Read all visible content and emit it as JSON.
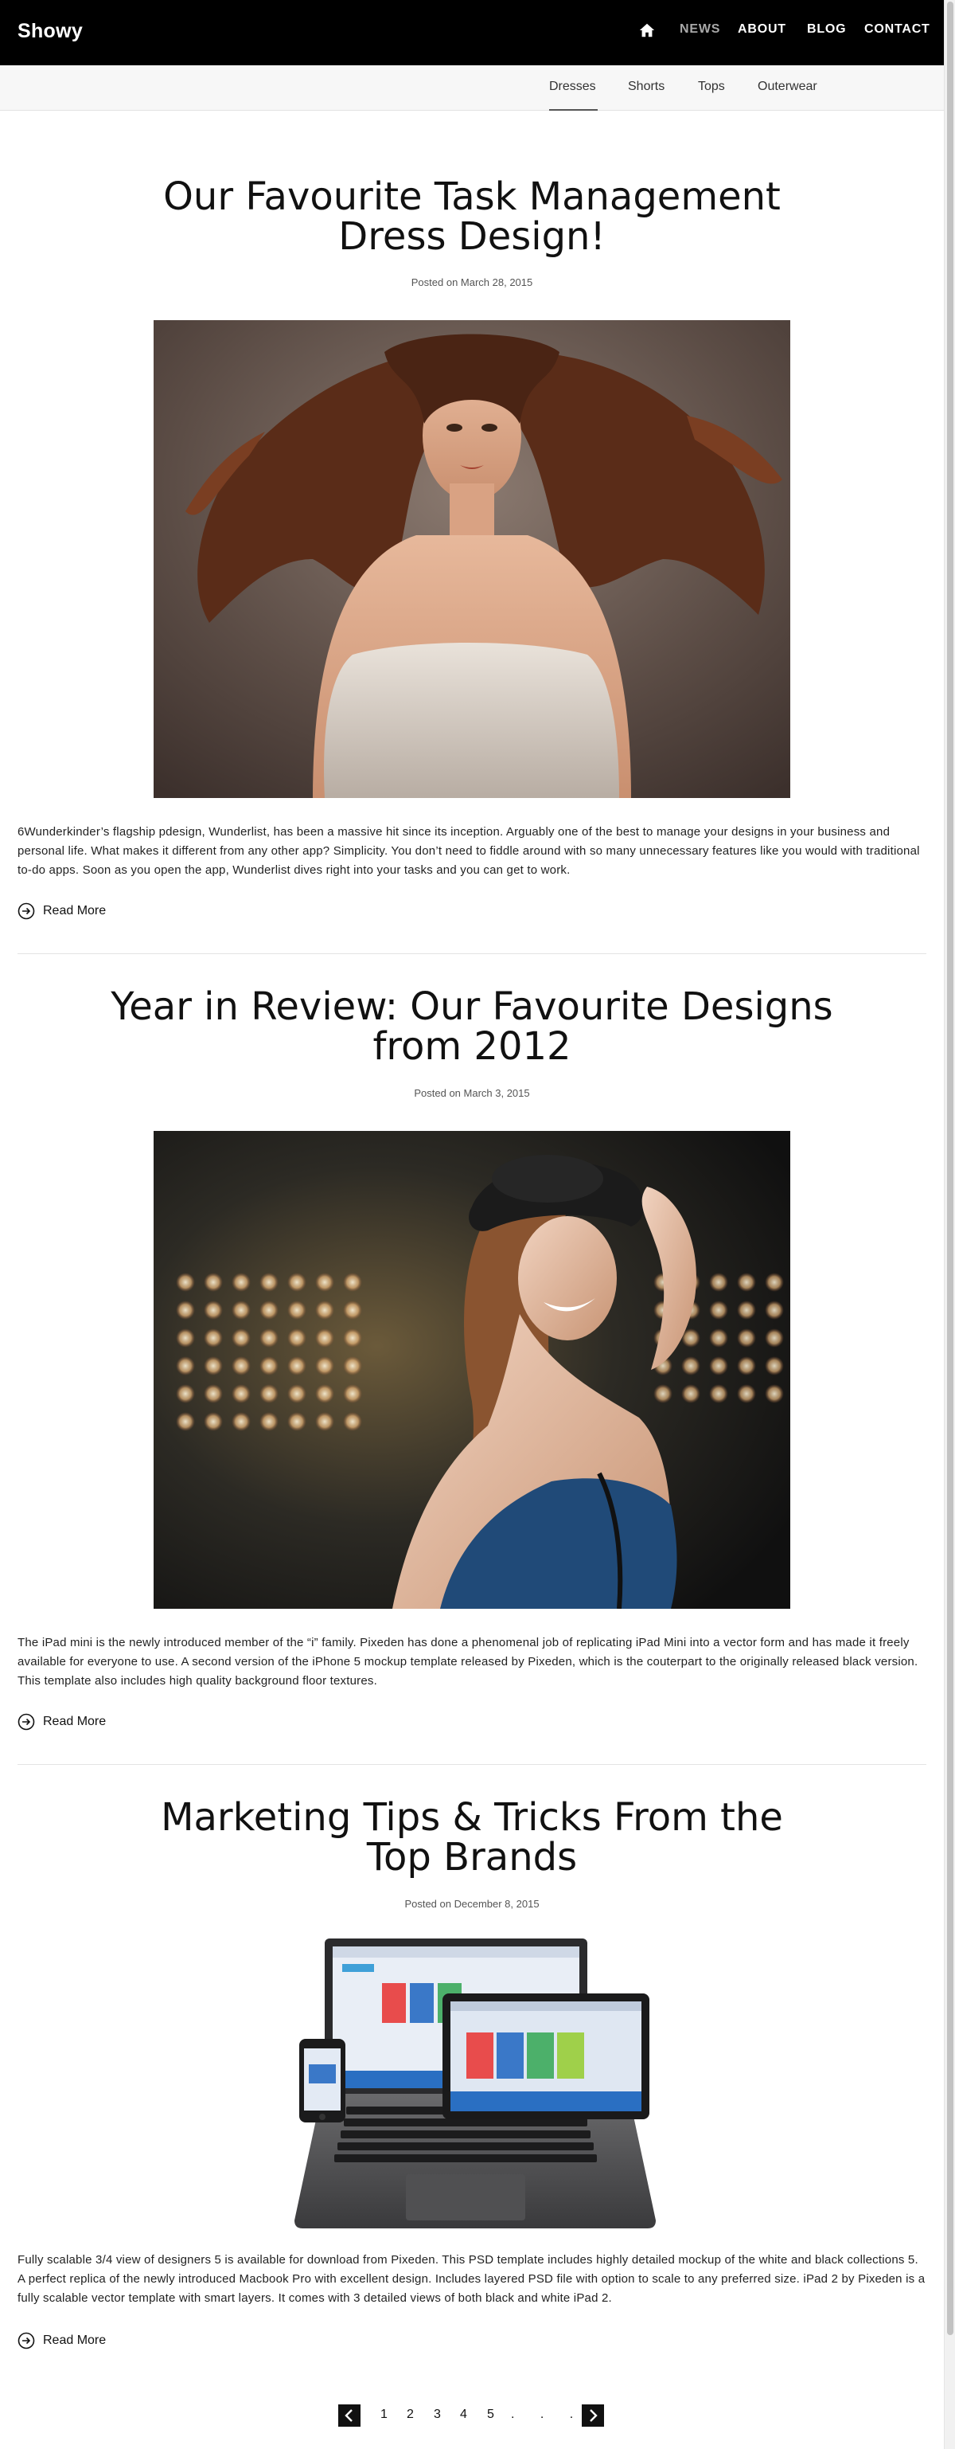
{
  "header": {
    "brand": "Showy",
    "nav": {
      "home_icon": "home-icon",
      "news": "NEWS",
      "about": "ABOUT",
      "blog": "BLOG",
      "contact": "CONTACT"
    },
    "subnav": [
      "Dresses",
      "Shorts",
      "Tops",
      "Outerwear"
    ],
    "active_subnav": "Dresses"
  },
  "posts": [
    {
      "title_line1": "Our Favourite Task Management",
      "title_line2": "Dress Design!",
      "date": "Posted on March 28, 2015",
      "image": "woman-flowing-hair-photo",
      "excerpt": "6Wunderkinder’s flagship pdesign, Wunderlist, has been a massive hit since its inception. Arguably one of the best to manage your designs in your business and personal life. What makes it different from any other app? Simplicity. You don’t need to fiddle around with so many unnecessary features like you would with traditional to-do apps. Soon as you open the app, Wunderlist dives right into your tasks and you can get to work.",
      "read_more": "Read More"
    },
    {
      "title_line1": "Year in Review: Our Favourite Designs",
      "title_line2": "from 2012",
      "date": "Posted on March 3, 2015",
      "image": "woman-in-hat-lights-photo",
      "excerpt": "The iPad mini is the newly introduced member of the “i” family. Pixeden has done a phenomenal job of replicating iPad Mini into a vector form and has made it freely available for everyone to use. A second version of the iPhone 5 mockup template released by Pixeden, which is the couterpart to the originally released black version. This template also includes high quality background floor textures.",
      "read_more": "Read More"
    },
    {
      "title_line1": "Marketing Tips & Tricks From the",
      "title_line2": "Top Brands",
      "date": "Posted on December 8, 2015",
      "image": "device-mockups-photo",
      "excerpt": "Fully scalable 3/4 view of designers 5 is available for download from Pixeden. This PSD template includes highly detailed mockup of the white and black collections 5. A perfect replica of the newly introduced Macbook Pro with excellent design. Includes layered PSD file with option to scale to any preferred size. iPad 2 by Pixeden is a fully scalable vector template with smart layers. It comes with 3 detailed views of both black and white iPad 2.",
      "read_more": "Read More"
    }
  ],
  "pagination": {
    "pages": [
      "1",
      "2",
      "3",
      "4",
      "5"
    ],
    "ellipsis": ". . .",
    "prev_icon": "chevron-left-icon",
    "next_icon": "chevron-right-icon"
  },
  "colors": {
    "header_bg": "#000000",
    "nav_active": "#a8a8a8",
    "subnav_bg": "#f7f7f7"
  }
}
